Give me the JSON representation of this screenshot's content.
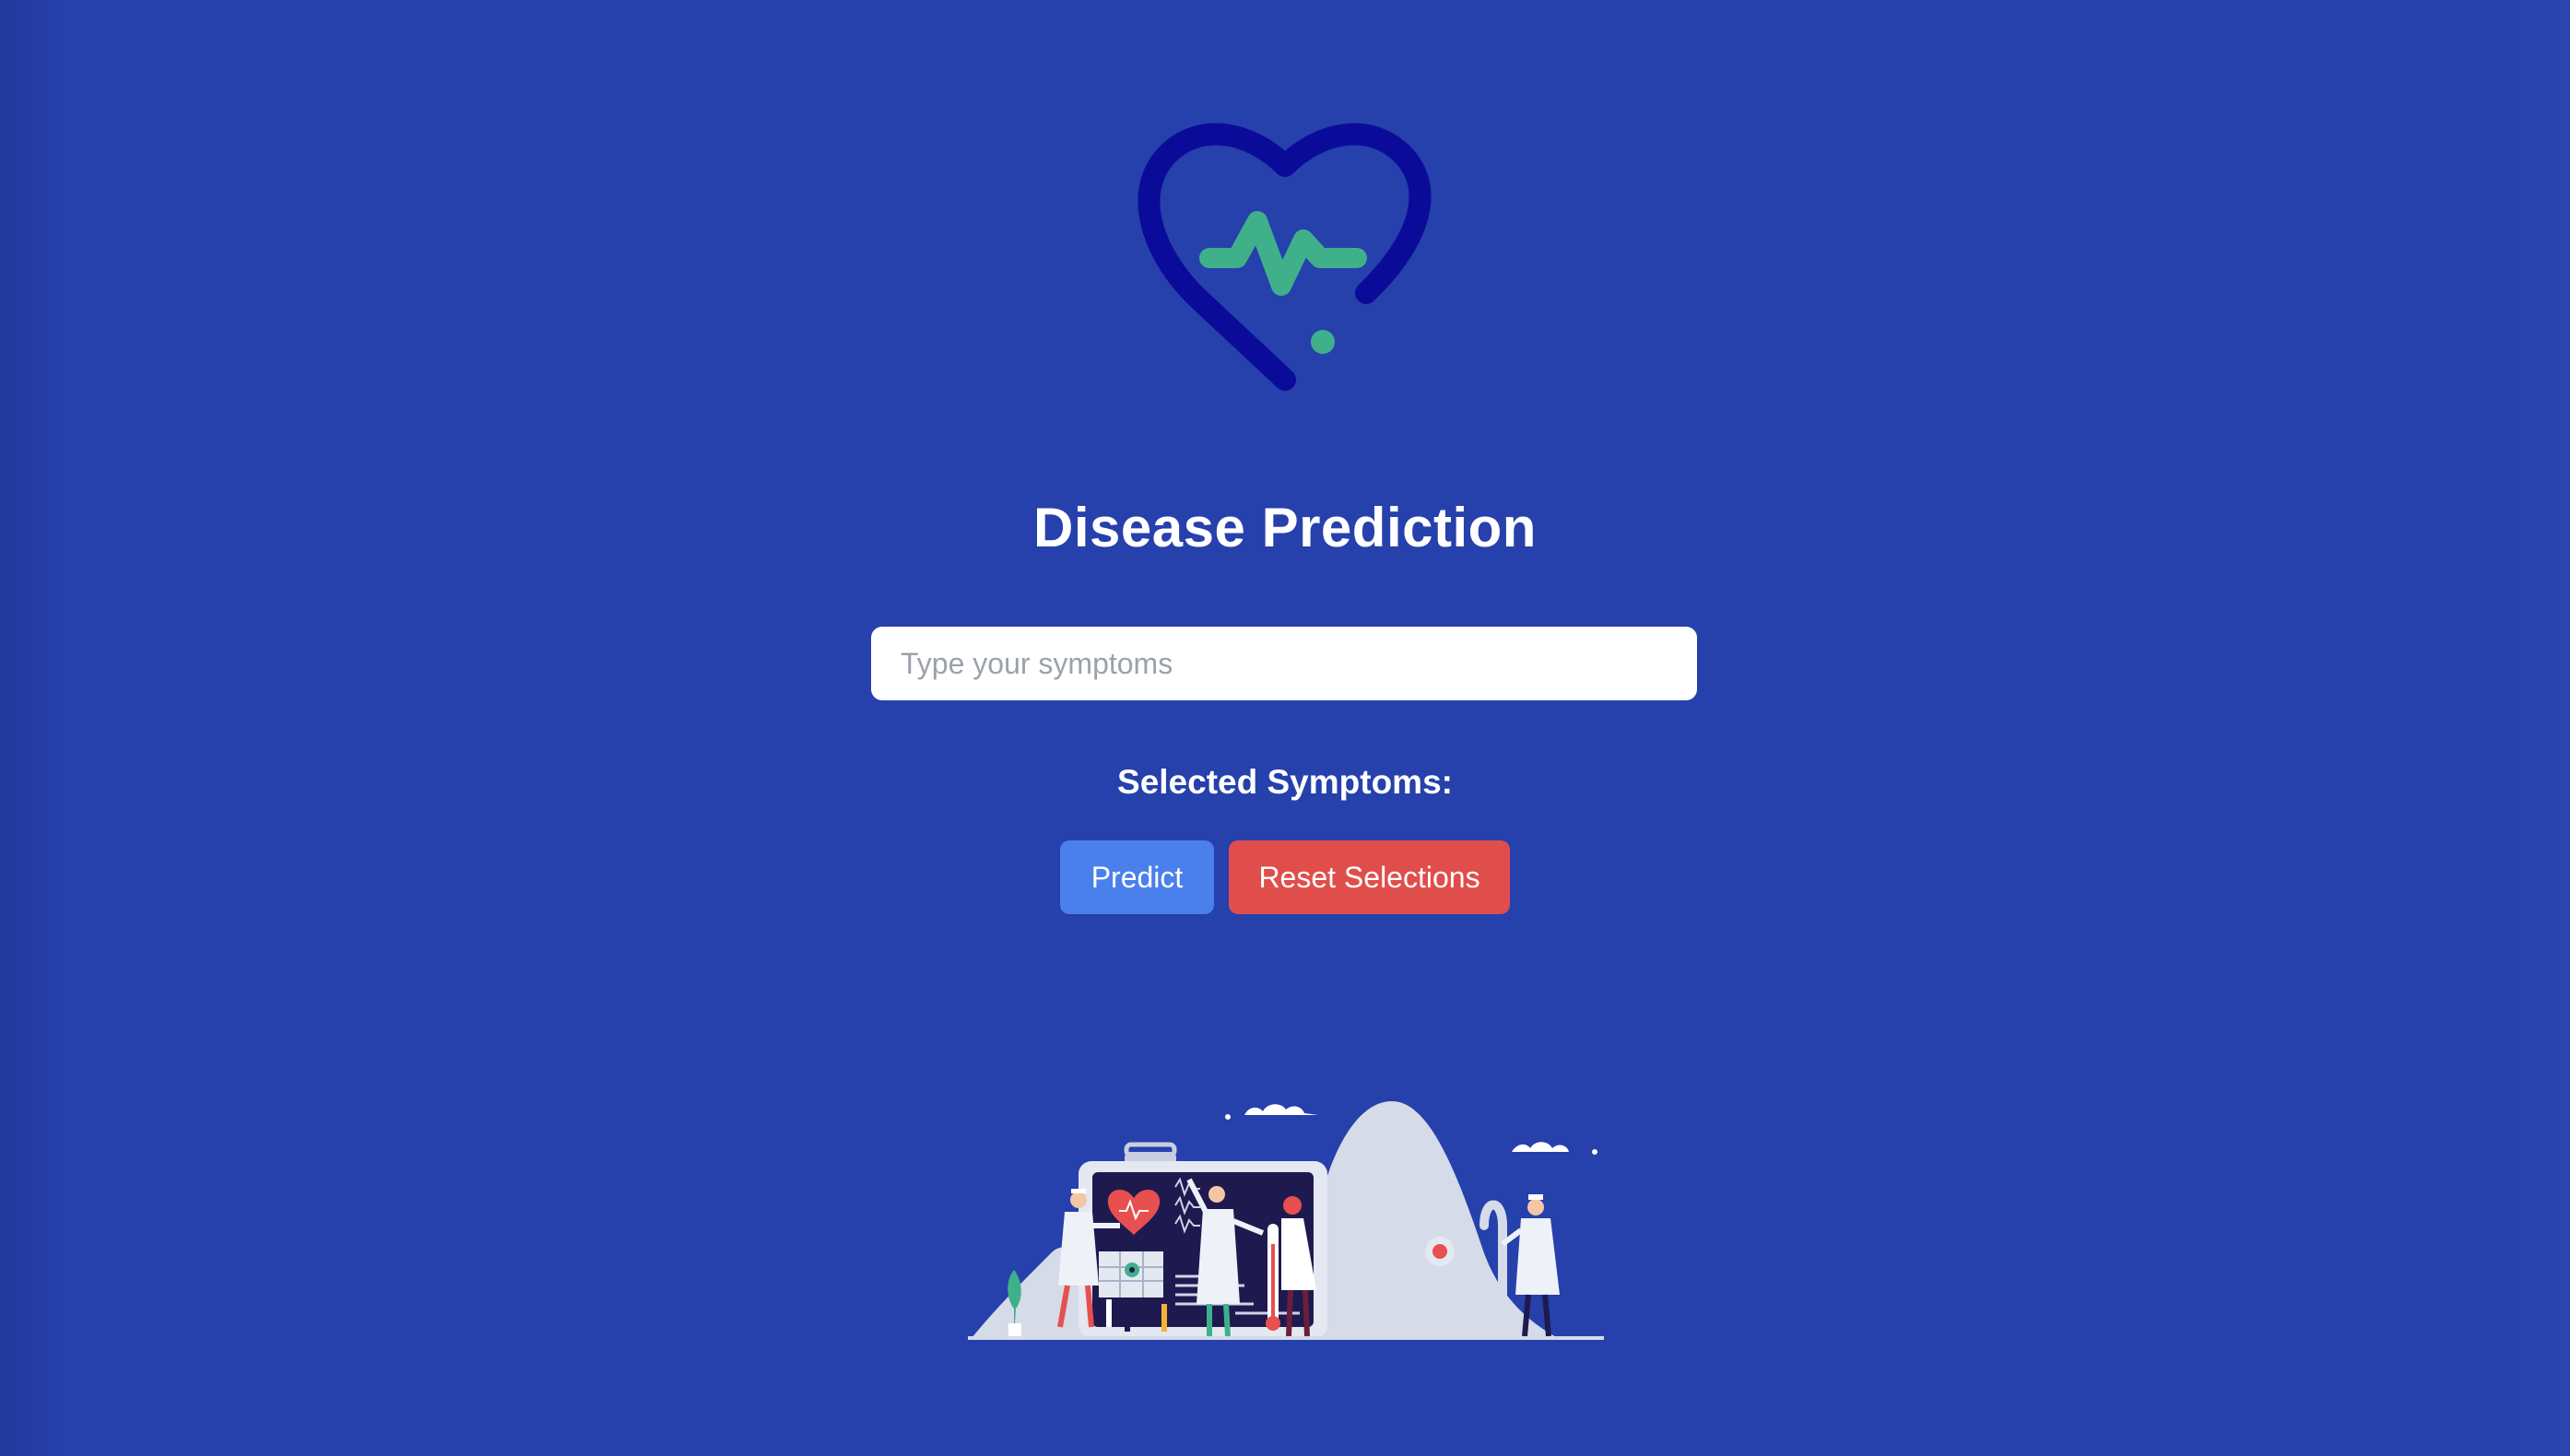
{
  "app": {
    "logo_icon": "heart-pulse-icon",
    "title": "Disease Prediction"
  },
  "search": {
    "placeholder": "Type your symptoms",
    "value": ""
  },
  "selected_symptoms": {
    "label": "Selected Symptoms:",
    "items": []
  },
  "actions": {
    "predict_label": "Predict",
    "reset_label": "Reset Selections"
  },
  "illustration": {
    "icon": "medical-team-illustration"
  },
  "colors": {
    "background": "#2640ac",
    "heart_outline": "#0b0b9a",
    "pulse_line": "#3fb08a",
    "predict_button": "#4a80ec",
    "reset_button": "#e04e4c"
  }
}
